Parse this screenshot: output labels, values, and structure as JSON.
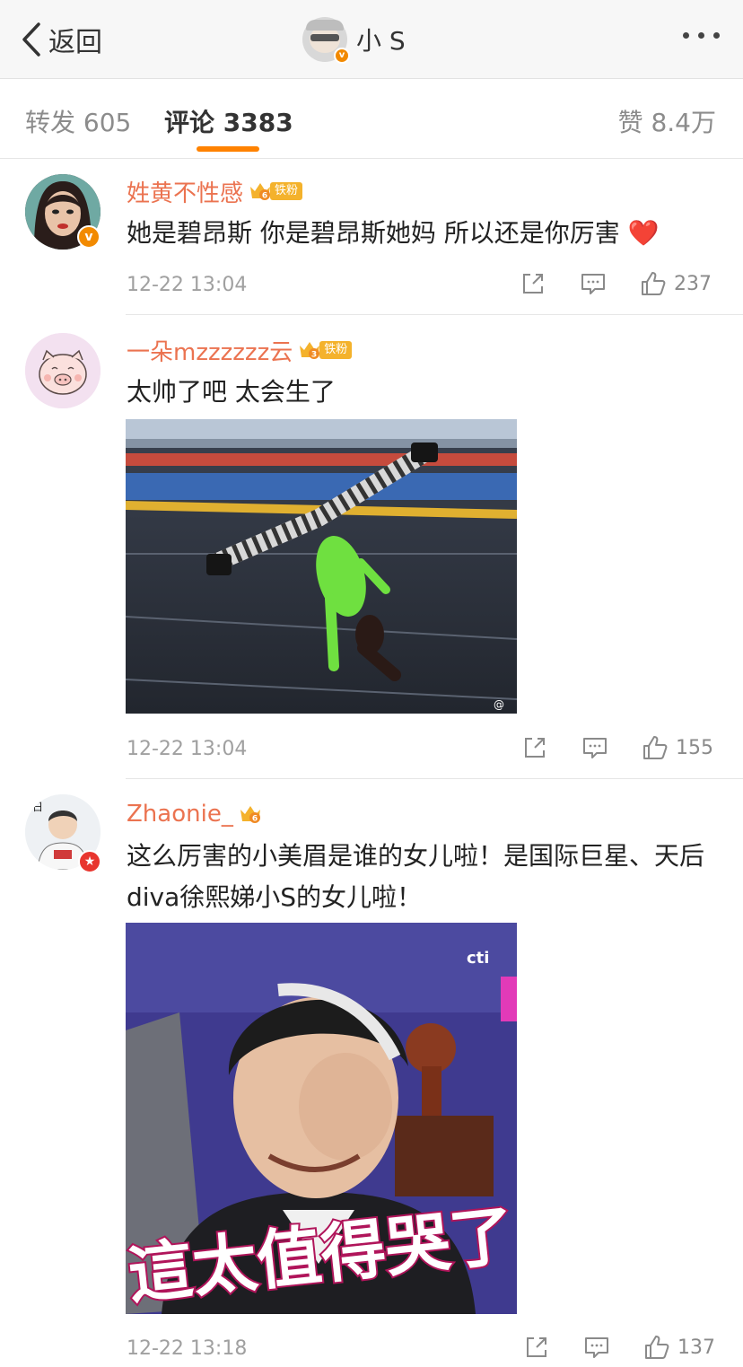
{
  "topbar": {
    "back_label": "返回",
    "title": "小 S",
    "verified_mark": "v"
  },
  "tabs": {
    "repost": "转发 605",
    "comments": "评论 3383",
    "likes": "赞 8.4万"
  },
  "colors": {
    "accent": "#ff8200",
    "username": "#eb7350",
    "verified_orange": "#f28a00",
    "verified_red": "#e8352e"
  },
  "comments": [
    {
      "username": "姓黄不性感",
      "fan_level": "6",
      "fan_label": "铁粉",
      "verified_mark": "v",
      "text": "她是碧昂斯 你是碧昂斯她妈 所以还是你厉害",
      "emoji": "❤️",
      "time": "12-22 13:04",
      "likes": "237"
    },
    {
      "username": "一朵mzzzzzz云",
      "fan_level": "3",
      "fan_label": "铁粉",
      "text": "太帅了吧 太会生了",
      "image": "dance-photo",
      "time": "12-22 13:04",
      "likes": "155"
    },
    {
      "username": "Zhaonie_",
      "fan_level": "6",
      "verified_mark": "★",
      "text": "这么厉害的小美眉是谁的女儿啦！是国际巨星、天后diva徐熙娣小S的女儿啦！",
      "image": "meme-photo",
      "image_caption": "這太值得哭了",
      "image_logo": "cti",
      "time": "12-22 13:18",
      "likes": "137"
    }
  ]
}
